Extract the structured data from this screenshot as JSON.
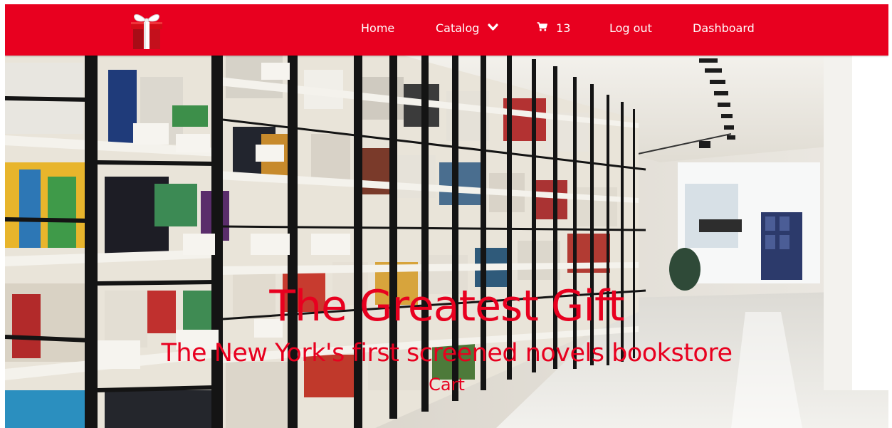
{
  "navbar": {
    "logo_icon": "gift-box-icon",
    "brand_color": "#e8001f",
    "items": [
      {
        "label": "Home"
      },
      {
        "label": "Catalog",
        "icon": "chevron-down-icon"
      },
      {
        "label": "13",
        "icon": "shopping-cart-icon"
      },
      {
        "label": "Log out"
      },
      {
        "label": "Dashboard"
      }
    ]
  },
  "hero": {
    "background": "library-bookshelves-photo",
    "title": "The Greatest Gift",
    "subtitle": "The New York's first screened novels bookstore",
    "link_label": "Cart",
    "text_color": "#e8001f"
  }
}
